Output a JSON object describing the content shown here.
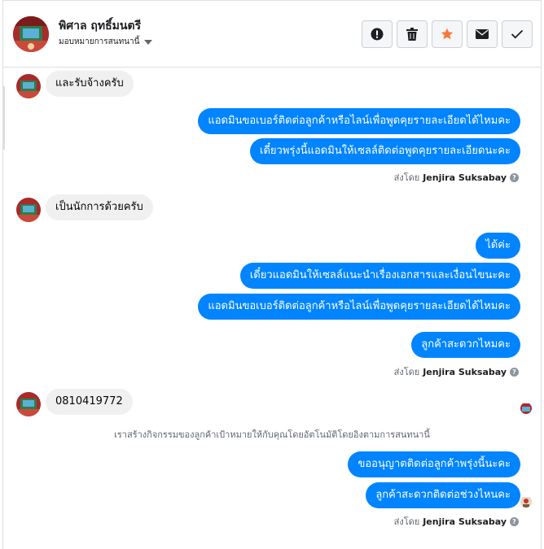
{
  "header": {
    "contact_name": "พิศาล ฤทธิ์มนตรี",
    "assign_label": "มอบหมายการสนทนานี้"
  },
  "actions": [
    {
      "name": "mark-spam",
      "icon": "exclamation-circle-icon"
    },
    {
      "name": "delete",
      "icon": "trash-icon"
    },
    {
      "name": "star",
      "icon": "star-icon"
    },
    {
      "name": "mark-unread",
      "icon": "envelope-icon"
    },
    {
      "name": "mark-done",
      "icon": "checkmark-icon"
    }
  ],
  "messages": {
    "m1": "และรับจ้างครับ",
    "m2": "แอดมินขอเบอร์ติดต่อลูกค้าหรือไลน์เพื่อพูดคุยรายละเอียดได้ไหมคะ",
    "m3": "เดี๋ยวพรุ่งนี้แอดมินให้เซลล์ติดต่อพูดคุยรายละเอียดนะคะ",
    "m4": "เป็นนักการด้วยครับ",
    "m5": "ได้ค่ะ",
    "m6": "เดี๋ยวแอดมินให้เซลล์แนะนำเรื่องเอกสารและเงื่อนไขนะคะ",
    "m7": "แอดมินขอเบอร์ติดต่อลูกค้าหรือไลน์เพื่อพูดคุยรายละเอียดได้ไหมคะ",
    "m8": "ลูกค้าสะดวกไหมคะ",
    "m9": "0810419772",
    "m10": "ขออนุญาตติดต่อลูกค้าพรุ่งนี้นะคะ",
    "m11": "ลูกค้าสะดวกติดต่อช่วงไหนคะ"
  },
  "sent_by": {
    "prefix": "ส่งโดย",
    "agent": "Jenjira Suksabay"
  },
  "notice": "เราสร้างกิจกรรมของลูกค้าเป้าหมายให้กับคุณโดยอัตโนมัติโดยอิงตามการสนทนานี้",
  "colors": {
    "outgoing_bubble": "#0084ff",
    "incoming_bubble": "#f1f0f0",
    "star_accent": "#f5793b"
  }
}
